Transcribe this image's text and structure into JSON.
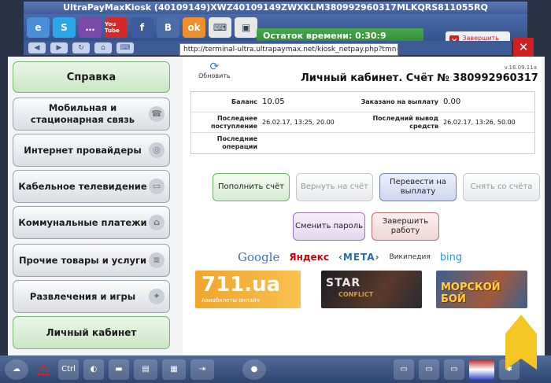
{
  "window": {
    "title": "UltraPayMaxKiosk (40109149)XWZ40109149ZWXKLM380992960317MLKQRS811055RQ"
  },
  "toolbar_icons": [
    {
      "name": "ie-icon",
      "label": "e"
    },
    {
      "name": "skype-icon",
      "label": "S"
    },
    {
      "name": "chat-icon",
      "label": "…"
    },
    {
      "name": "youtube-icon",
      "label": "You Tube"
    },
    {
      "name": "facebook-icon",
      "label": "f"
    },
    {
      "name": "vk-icon",
      "label": "B"
    },
    {
      "name": "odnoklassniki-icon",
      "label": "ok"
    },
    {
      "name": "keyboard-icon",
      "label": "⌨"
    },
    {
      "name": "video-icon",
      "label": "▣"
    }
  ],
  "timer": {
    "label": "Остаток времени: 0:30:9"
  },
  "finish_button": {
    "label": "Завершить работу"
  },
  "address": {
    "url": "http://terminal-ultra.ultrapaymax.net/kiosk_netpay.php?tmn="
  },
  "sidebar": {
    "items": [
      {
        "label": "Справка",
        "name": "sidebar-item-help"
      },
      {
        "label": "Мобильная и стационарная связь",
        "name": "sidebar-item-mobile"
      },
      {
        "label": "Интернет провайдеры",
        "name": "sidebar-item-internet"
      },
      {
        "label": "Кабельное телевидение",
        "name": "sidebar-item-cable-tv"
      },
      {
        "label": "Коммунальные платежи",
        "name": "sidebar-item-utilities"
      },
      {
        "label": "Прочие товары и услуги",
        "name": "sidebar-item-other"
      },
      {
        "label": "Развлечения и игры",
        "name": "sidebar-item-entertainment"
      },
      {
        "label": "Личный кабинет",
        "name": "sidebar-item-account"
      }
    ]
  },
  "cabinet": {
    "refresh_label": "Обновить",
    "version": "v.16.09.11a",
    "title": "Личный кабинет. Счёт № 380992960317",
    "balance_label": "Баланс",
    "balance_value": "10.05",
    "ordered_label": "Заказано на выплату",
    "ordered_value": "0.00",
    "last_deposit_label": "Последнее поступление",
    "last_deposit_value": "26.02.17, 13:25, 20.00",
    "last_withdraw_label": "Последний вывод средств",
    "last_withdraw_value": "26.02.17, 13:26, 50.00",
    "last_ops_label": "Последние операции"
  },
  "actions": {
    "topup": "Пополнить счёт",
    "refund": "Вернуть на счёт",
    "transfer": "Перевести на выплату",
    "withdraw": "Снять со счёта",
    "change_password": "Сменить пароль",
    "finish": "Завершить работу"
  },
  "search_engines": [
    "Google",
    "Яндекс",
    "‹META›",
    "Википедия",
    "bing"
  ],
  "banners": {
    "b1_big": "711.ua",
    "b1_small": "Авиабилеты онлайн",
    "b2_title": "STAR",
    "b2_sub": "CONFLICT",
    "b3_title": "МОРСКОЙ БОЙ"
  }
}
